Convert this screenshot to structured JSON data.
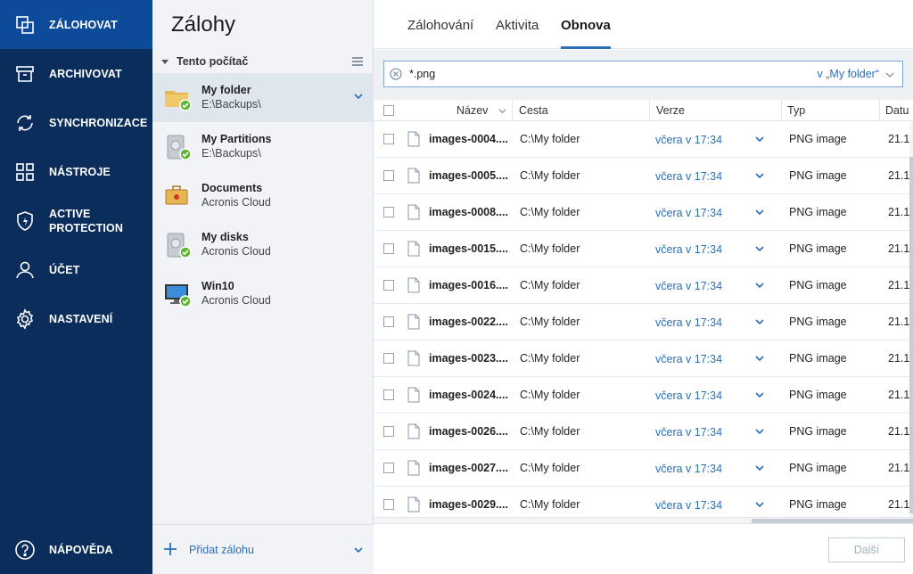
{
  "nav": {
    "items": [
      {
        "label": "ZÁLOHOVAT",
        "icon": "backup-icon"
      },
      {
        "label": "ARCHIVOVAT",
        "icon": "archive-icon"
      },
      {
        "label": "SYNCHRONIZACE",
        "icon": "sync-icon"
      },
      {
        "label": "NÁSTROJE",
        "icon": "tools-icon"
      },
      {
        "label": "ACTIVE\nPROTECTION",
        "icon": "shield-icon"
      },
      {
        "label": "ÚČET",
        "icon": "user-icon"
      },
      {
        "label": "NASTAVENÍ",
        "icon": "gear-icon"
      }
    ],
    "help_label": "NÁPOVĚDA",
    "active_color": "#0d4a9a",
    "bg_color": "#0a2d5b"
  },
  "backups": {
    "title": "Zálohy",
    "section": "Tento počítač",
    "items": [
      {
        "name": "My folder",
        "location": "E:\\Backups\\",
        "icon": "folder-icon"
      },
      {
        "name": "My Partitions",
        "location": "E:\\Backups\\",
        "icon": "disk-icon"
      },
      {
        "name": "Documents",
        "location": "Acronis Cloud",
        "icon": "briefcase-icon"
      },
      {
        "name": "My disks",
        "location": "Acronis Cloud",
        "icon": "disk-icon"
      },
      {
        "name": "Win10",
        "location": "Acronis Cloud",
        "icon": "monitor-icon"
      }
    ],
    "add_label": "Přidat zálohu"
  },
  "tabs": [
    {
      "label": "Zálohování"
    },
    {
      "label": "Aktivita"
    },
    {
      "label": "Obnova"
    }
  ],
  "search": {
    "value": "*.png",
    "scope": "v „My folder“"
  },
  "table": {
    "columns": {
      "name": "Název",
      "path": "Cesta",
      "version": "Verze",
      "type": "Typ",
      "date": "Datu"
    },
    "rows": [
      {
        "name": "images-0004....",
        "path": "C:\\My folder",
        "version": "včera v 17:34",
        "type": "PNG image",
        "date": "21.1"
      },
      {
        "name": "images-0005....",
        "path": "C:\\My folder",
        "version": "včera v 17:34",
        "type": "PNG image",
        "date": "21.1"
      },
      {
        "name": "images-0008....",
        "path": "C:\\My folder",
        "version": "včera v 17:34",
        "type": "PNG image",
        "date": "21.1"
      },
      {
        "name": "images-0015....",
        "path": "C:\\My folder",
        "version": "včera v 17:34",
        "type": "PNG image",
        "date": "21.1"
      },
      {
        "name": "images-0016....",
        "path": "C:\\My folder",
        "version": "včera v 17:34",
        "type": "PNG image",
        "date": "21.1"
      },
      {
        "name": "images-0022....",
        "path": "C:\\My folder",
        "version": "včera v 17:34",
        "type": "PNG image",
        "date": "21.1"
      },
      {
        "name": "images-0023....",
        "path": "C:\\My folder",
        "version": "včera v 17:34",
        "type": "PNG image",
        "date": "21.1"
      },
      {
        "name": "images-0024....",
        "path": "C:\\My folder",
        "version": "včera v 17:34",
        "type": "PNG image",
        "date": "21.1"
      },
      {
        "name": "images-0026....",
        "path": "C:\\My folder",
        "version": "včera v 17:34",
        "type": "PNG image",
        "date": "21.1"
      },
      {
        "name": "images-0027....",
        "path": "C:\\My folder",
        "version": "včera v 17:34",
        "type": "PNG image",
        "date": "21.1"
      },
      {
        "name": "images-0029....",
        "path": "C:\\My folder",
        "version": "včera v 17:34",
        "type": "PNG image",
        "date": "21.1"
      }
    ]
  },
  "footer": {
    "next_label": "Další"
  }
}
